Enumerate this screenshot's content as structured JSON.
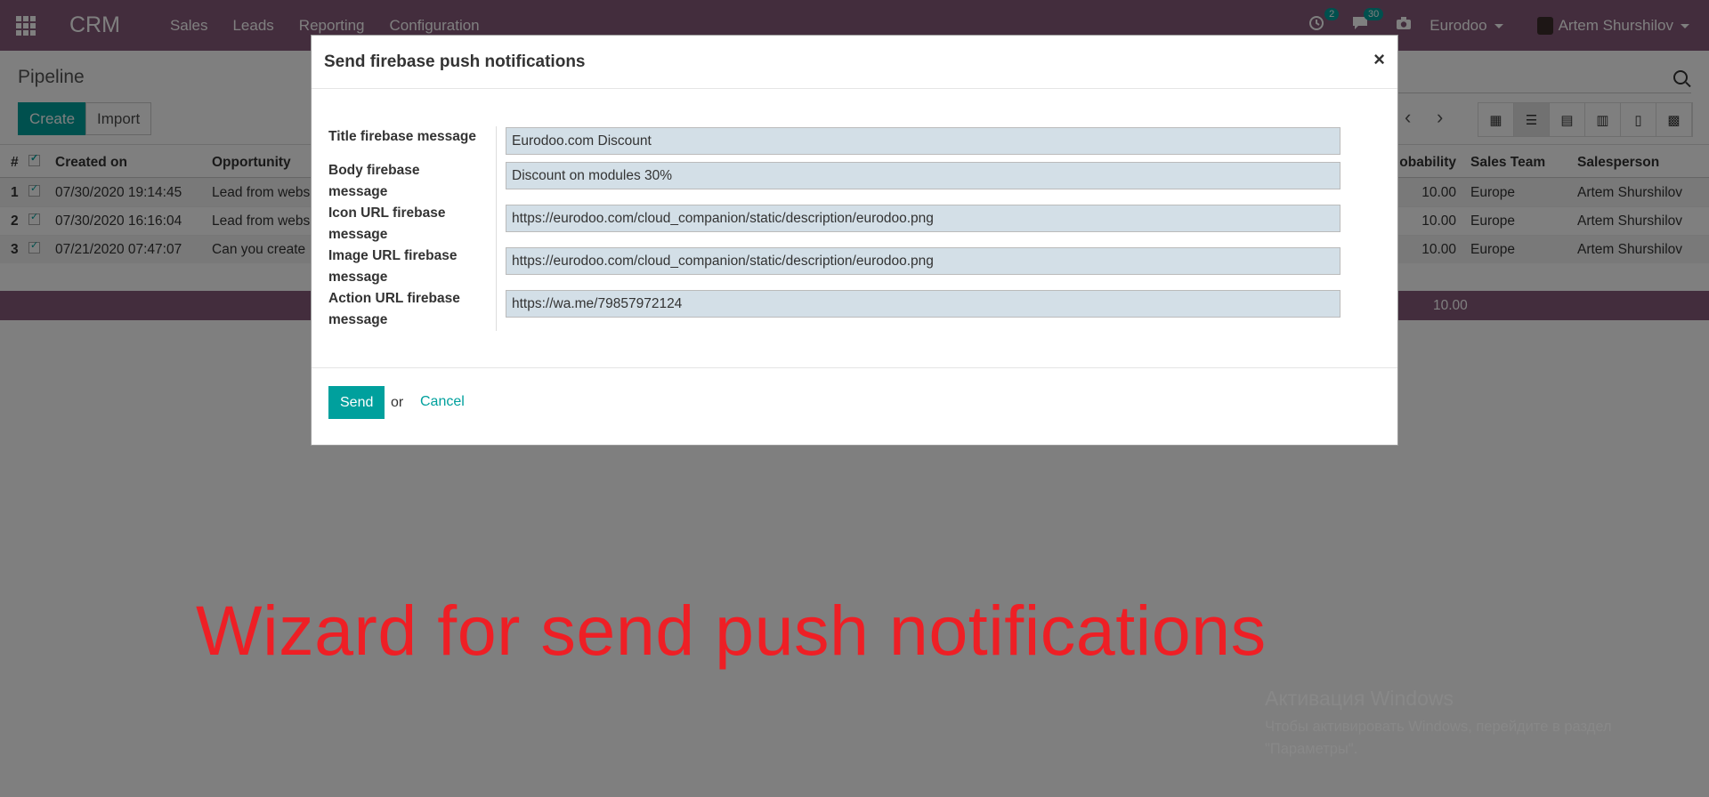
{
  "navbar": {
    "brand": "CRM",
    "menu": [
      "Sales",
      "Leads",
      "Reporting",
      "Configuration"
    ],
    "activity_badge": "2",
    "messages_badge": "30",
    "company": "Eurodoo",
    "user": "Artem Shurshilov"
  },
  "control_panel": {
    "breadcrumb": "Pipeline",
    "create_label": "Create",
    "import_label": "Import"
  },
  "list": {
    "columns": {
      "num": "#",
      "created_on": "Created on",
      "opportunity": "Opportunity",
      "probability": "obability",
      "sales_team": "Sales Team",
      "salesperson": "Salesperson"
    },
    "rows": [
      {
        "num": "1",
        "created_on": "07/30/2020 19:14:45",
        "opportunity": "Lead from webs",
        "probability": "10.00",
        "sales_team": "Europe",
        "salesperson": "Artem Shurshilov"
      },
      {
        "num": "2",
        "created_on": "07/30/2020 16:16:04",
        "opportunity": "Lead from webs",
        "probability": "10.00",
        "sales_team": "Europe",
        "salesperson": "Artem Shurshilov"
      },
      {
        "num": "3",
        "created_on": "07/21/2020 07:47:07",
        "opportunity": "Can you create",
        "probability": "10.00",
        "sales_team": "Europe",
        "salesperson": "Artem Shurshilov"
      }
    ],
    "total_probability": "10.00"
  },
  "modal": {
    "title": "Send firebase push notifications",
    "close": "×",
    "fields": [
      {
        "label": "Title firebase message",
        "value": "Eurodoo.com Discount"
      },
      {
        "label": "Body firebase message",
        "value": "Discount on modules 30%"
      },
      {
        "label": "Icon URL firebase message",
        "value": "https://eurodoo.com/cloud_companion/static/description/eurodoo.png"
      },
      {
        "label": "Image URL firebase message",
        "value": "https://eurodoo.com/cloud_companion/static/description/eurodoo.png"
      },
      {
        "label": "Action URL firebase message",
        "value": "https://wa.me/79857972124"
      }
    ],
    "send_label": "Send",
    "or_label": "or",
    "cancel_label": "Cancel"
  },
  "caption": "Wizard for send push notifications",
  "watermark": {
    "title": "Активация Windows",
    "line1": "Чтобы активировать Windows, перейдите в раздел",
    "line2": "\"Параметры\"."
  },
  "colors": {
    "navbar": "#875a7b",
    "primary": "#00a09d",
    "caption": "#ee1f25",
    "input_bg": "#d3dfe7"
  },
  "icons": {
    "apps": "apps-grid-icon",
    "activity": "clock-icon",
    "messages": "chat-icon",
    "camera": "camera-icon",
    "search": "search-icon",
    "close": "close-icon"
  }
}
